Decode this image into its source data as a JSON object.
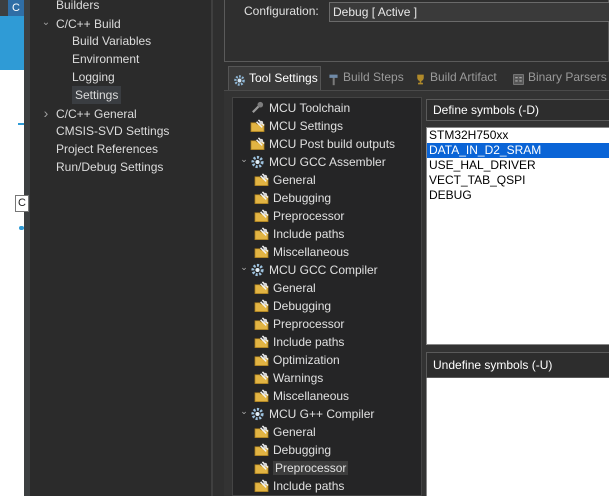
{
  "left_tree": {
    "items": [
      {
        "label": "Builders",
        "level": 1,
        "arrow": ""
      },
      {
        "label": "C/C++ Build",
        "level": 1,
        "arrow": "expanded"
      },
      {
        "label": "Build Variables",
        "level": 2,
        "arrow": ""
      },
      {
        "label": "Environment",
        "level": 2,
        "arrow": ""
      },
      {
        "label": "Logging",
        "level": 2,
        "arrow": ""
      },
      {
        "label": "Settings",
        "level": 2,
        "arrow": "",
        "selected": true
      },
      {
        "label": "C/C++ General",
        "level": 1,
        "arrow": "collapsed"
      },
      {
        "label": "CMSIS-SVD Settings",
        "level": 1,
        "arrow": ""
      },
      {
        "label": "Project References",
        "level": 1,
        "arrow": ""
      },
      {
        "label": "Run/Debug Settings",
        "level": 1,
        "arrow": ""
      }
    ]
  },
  "left_edge": {
    "field_text": "C",
    "tab_glyph": "C"
  },
  "config": {
    "label": "Configuration:",
    "value": "Debug  [ Active ]"
  },
  "tabs": [
    {
      "label": "Tool Settings",
      "active": true,
      "icon": "gear-icon"
    },
    {
      "label": "Build Steps",
      "active": false,
      "icon": "hammer-icon"
    },
    {
      "label": "Build Artifact",
      "active": false,
      "icon": "trophy-icon"
    },
    {
      "label": "Binary Parsers",
      "active": false,
      "icon": "binary-icon"
    }
  ],
  "tool_tree": {
    "items": [
      {
        "label": "MCU Toolchain",
        "level": 1,
        "arrow": "",
        "icon": "toolchain-icon"
      },
      {
        "label": "MCU Settings",
        "level": 1,
        "arrow": "",
        "icon": "folder-icon"
      },
      {
        "label": "MCU Post build outputs",
        "level": 1,
        "arrow": "",
        "icon": "folder-icon"
      },
      {
        "label": "MCU GCC Assembler",
        "level": 1,
        "arrow": "expanded",
        "icon": "tool-gear-icon"
      },
      {
        "label": "General",
        "level": 2,
        "arrow": "",
        "icon": "folder-icon"
      },
      {
        "label": "Debugging",
        "level": 2,
        "arrow": "",
        "icon": "folder-icon"
      },
      {
        "label": "Preprocessor",
        "level": 2,
        "arrow": "",
        "icon": "folder-icon"
      },
      {
        "label": "Include paths",
        "level": 2,
        "arrow": "",
        "icon": "folder-icon"
      },
      {
        "label": "Miscellaneous",
        "level": 2,
        "arrow": "",
        "icon": "folder-icon"
      },
      {
        "label": "MCU GCC Compiler",
        "level": 1,
        "arrow": "expanded",
        "icon": "tool-gear-icon"
      },
      {
        "label": "General",
        "level": 2,
        "arrow": "",
        "icon": "folder-icon"
      },
      {
        "label": "Debugging",
        "level": 2,
        "arrow": "",
        "icon": "folder-icon"
      },
      {
        "label": "Preprocessor",
        "level": 2,
        "arrow": "",
        "icon": "folder-icon"
      },
      {
        "label": "Include paths",
        "level": 2,
        "arrow": "",
        "icon": "folder-icon"
      },
      {
        "label": "Optimization",
        "level": 2,
        "arrow": "",
        "icon": "folder-icon"
      },
      {
        "label": "Warnings",
        "level": 2,
        "arrow": "",
        "icon": "folder-icon"
      },
      {
        "label": "Miscellaneous",
        "level": 2,
        "arrow": "",
        "icon": "folder-icon"
      },
      {
        "label": "MCU G++ Compiler",
        "level": 1,
        "arrow": "expanded",
        "icon": "tool-gear-icon"
      },
      {
        "label": "General",
        "level": 2,
        "arrow": "",
        "icon": "folder-icon"
      },
      {
        "label": "Debugging",
        "level": 2,
        "arrow": "",
        "icon": "folder-icon"
      },
      {
        "label": "Preprocessor",
        "level": 2,
        "arrow": "",
        "icon": "folder-icon",
        "selected": true
      },
      {
        "label": "Include paths",
        "level": 2,
        "arrow": "",
        "icon": "folder-icon"
      }
    ]
  },
  "define_symbols": {
    "header": "Define symbols (-D)",
    "items": [
      {
        "label": "STM32H750xx",
        "selected": false
      },
      {
        "label": "DATA_IN_D2_SRAM",
        "selected": true
      },
      {
        "label": "USE_HAL_DRIVER",
        "selected": false
      },
      {
        "label": "VECT_TAB_QSPI",
        "selected": false
      },
      {
        "label": "DEBUG",
        "selected": false
      }
    ]
  },
  "undefine_symbols": {
    "header": "Undefine symbols (-U)",
    "items": []
  },
  "colors": {
    "accent": "#2f9bd6",
    "selection": "#0a64d6",
    "background": "#2b2b2b"
  }
}
